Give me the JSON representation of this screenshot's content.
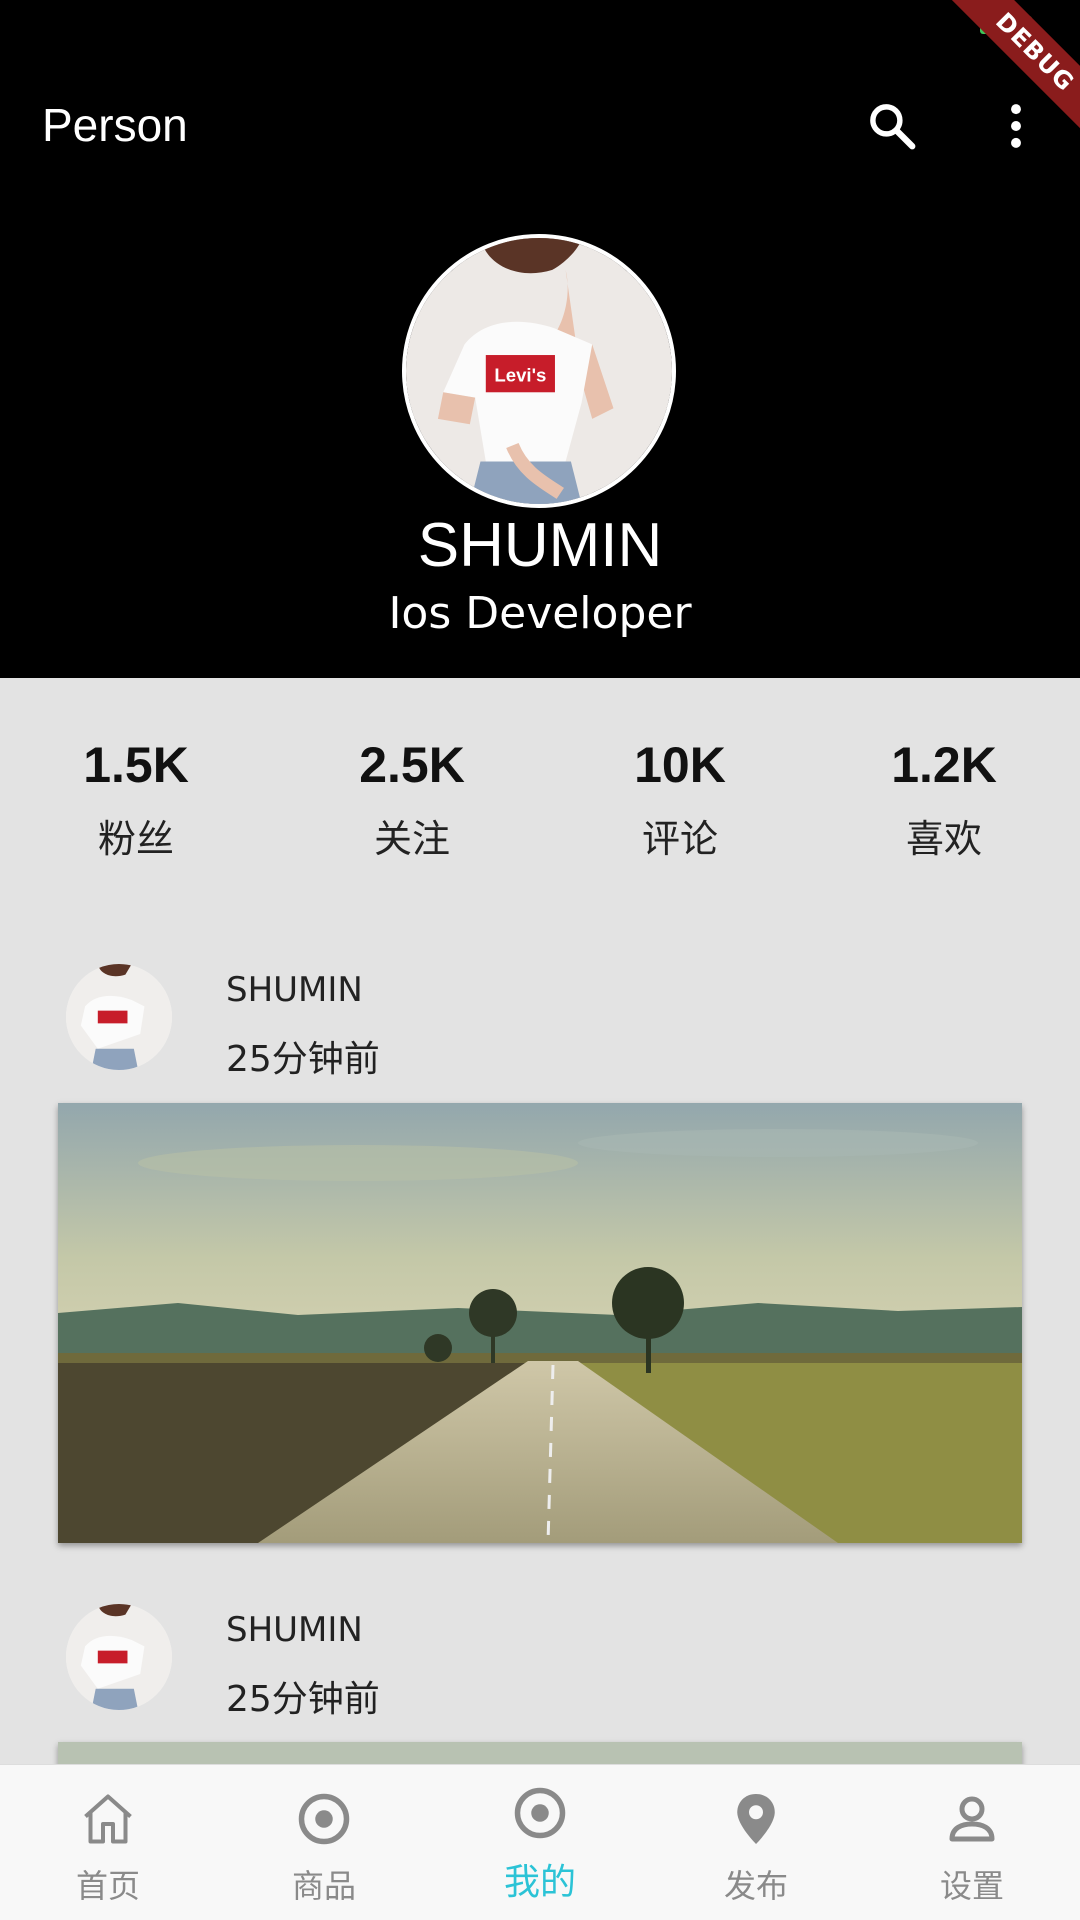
{
  "status_bar": {
    "debug_label": "DEBUG",
    "battery_color": "#3ec55a"
  },
  "appbar": {
    "title": "Person",
    "search_icon": "search-icon",
    "more_icon": "more-vert-icon"
  },
  "profile": {
    "name": "SHUMIN",
    "role": "Ios Developer"
  },
  "stats": [
    {
      "value": "1.5K",
      "label": "粉丝"
    },
    {
      "value": "2.5K",
      "label": "关注"
    },
    {
      "value": "10K",
      "label": "评论"
    },
    {
      "value": "1.2K",
      "label": "喜欢"
    }
  ],
  "posts": [
    {
      "author": "SHUMIN",
      "time": "25分钟前"
    },
    {
      "author": "SHUMIN",
      "time": "25分钟前"
    }
  ],
  "bottom_nav": {
    "active_color": "#2bc3d6",
    "inactive_color": "#8a8a8a",
    "items": [
      {
        "label": "首页",
        "icon": "home-icon"
      },
      {
        "label": "商品",
        "icon": "radio-icon"
      },
      {
        "label": "我的",
        "icon": "radio-icon",
        "active": true
      },
      {
        "label": "发布",
        "icon": "location-pin-icon"
      },
      {
        "label": "设置",
        "icon": "person-icon"
      }
    ]
  }
}
